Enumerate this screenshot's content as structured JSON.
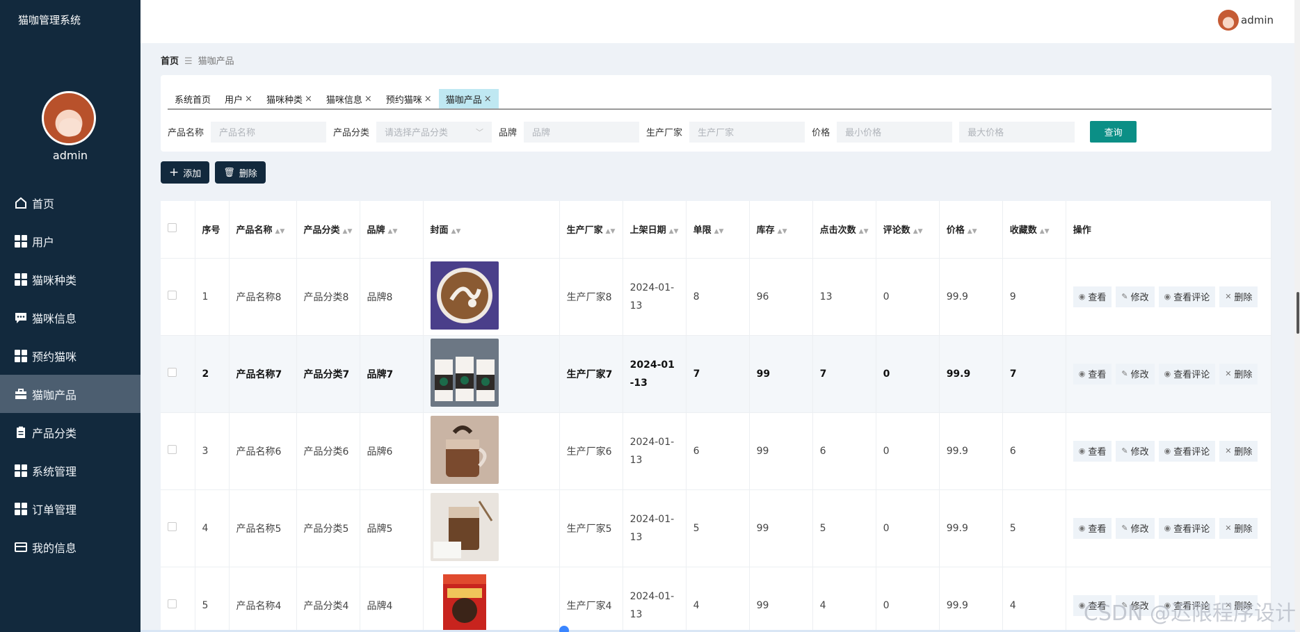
{
  "app": {
    "title": "猫咖管理系统",
    "username": "admin"
  },
  "nav": [
    {
      "label": "首页",
      "icon": "home-icon"
    },
    {
      "label": "用户",
      "icon": "grid-icon"
    },
    {
      "label": "猫咪种类",
      "icon": "grid-icon"
    },
    {
      "label": "猫咪信息",
      "icon": "chat-icon"
    },
    {
      "label": "预约猫咪",
      "icon": "grid-icon"
    },
    {
      "label": "猫咖产品",
      "icon": "briefcase-icon",
      "active": true
    },
    {
      "label": "产品分类",
      "icon": "clipboard-icon"
    },
    {
      "label": "系统管理",
      "icon": "grid-icon"
    },
    {
      "label": "订单管理",
      "icon": "grid-icon"
    },
    {
      "label": "我的信息",
      "icon": "card-icon"
    }
  ],
  "breadcrumb": {
    "home": "首页",
    "current": "猫咖产品"
  },
  "tabs": [
    {
      "label": "系统首页",
      "closable": false
    },
    {
      "label": "用户",
      "closable": true
    },
    {
      "label": "猫咪种类",
      "closable": true
    },
    {
      "label": "猫咪信息",
      "closable": true
    },
    {
      "label": "预约猫咪",
      "closable": true
    },
    {
      "label": "猫咖产品",
      "closable": true,
      "active": true
    }
  ],
  "filters": {
    "name_label": "产品名称",
    "name_placeholder": "产品名称",
    "category_label": "产品分类",
    "category_placeholder": "请选择产品分类",
    "brand_label": "品牌",
    "brand_placeholder": "品牌",
    "maker_label": "生产厂家",
    "maker_placeholder": "生产厂家",
    "price_label": "价格",
    "min_placeholder": "最小价格",
    "max_placeholder": "最大价格",
    "query": "查询"
  },
  "actions": {
    "add": "添加",
    "delete": "删除"
  },
  "table": {
    "headers": [
      "序号",
      "产品名称",
      "产品分类",
      "品牌",
      "封面",
      "生产厂家",
      "上架日期",
      "单限",
      "库存",
      "点击次数",
      "评论数",
      "价格",
      "收藏数",
      "操作"
    ],
    "op_labels": {
      "view": "查看",
      "edit": "修改",
      "comments": "查看评论",
      "delete": "删除"
    },
    "rows": [
      {
        "no": "1",
        "name": "产品名称8",
        "category": "产品分类8",
        "brand": "品牌8",
        "maker": "生产厂家8",
        "date": "2024-01-13",
        "limit": "8",
        "stock": "96",
        "clicks": "13",
        "comments": "0",
        "price": "99.9",
        "favs": "9",
        "cover": "latte-art"
      },
      {
        "no": "2",
        "name": "产品名称7",
        "category": "产品分类7",
        "brand": "品牌7",
        "maker": "生产厂家7",
        "date": "2024-01-13",
        "limit": "7",
        "stock": "99",
        "clicks": "7",
        "comments": "0",
        "price": "99.9",
        "favs": "7",
        "cover": "starbucks-cups"
      },
      {
        "no": "3",
        "name": "产品名称6",
        "category": "产品分类6",
        "brand": "品牌6",
        "maker": "生产厂家6",
        "date": "2024-01-13",
        "limit": "6",
        "stock": "99",
        "clicks": "6",
        "comments": "0",
        "price": "99.9",
        "favs": "6",
        "cover": "mocha-cup"
      },
      {
        "no": "4",
        "name": "产品名称5",
        "category": "产品分类5",
        "brand": "品牌5",
        "maker": "生产厂家5",
        "date": "2024-01-13",
        "limit": "5",
        "stock": "99",
        "clicks": "5",
        "comments": "0",
        "price": "99.9",
        "favs": "5",
        "cover": "iced-coffee"
      },
      {
        "no": "5",
        "name": "产品名称4",
        "category": "产品分类4",
        "brand": "品牌4",
        "maker": "生产厂家4",
        "date": "2024-01-13",
        "limit": "4",
        "stock": "99",
        "clicks": "4",
        "comments": "0",
        "price": "99.9",
        "favs": "4",
        "cover": "coffee-bag"
      }
    ]
  },
  "watermark": "CSDN @迟限程序设计",
  "colors": {
    "sidebar": "#12293d",
    "accent": "#0b8f86",
    "active_tab": "#bfe8f2"
  }
}
